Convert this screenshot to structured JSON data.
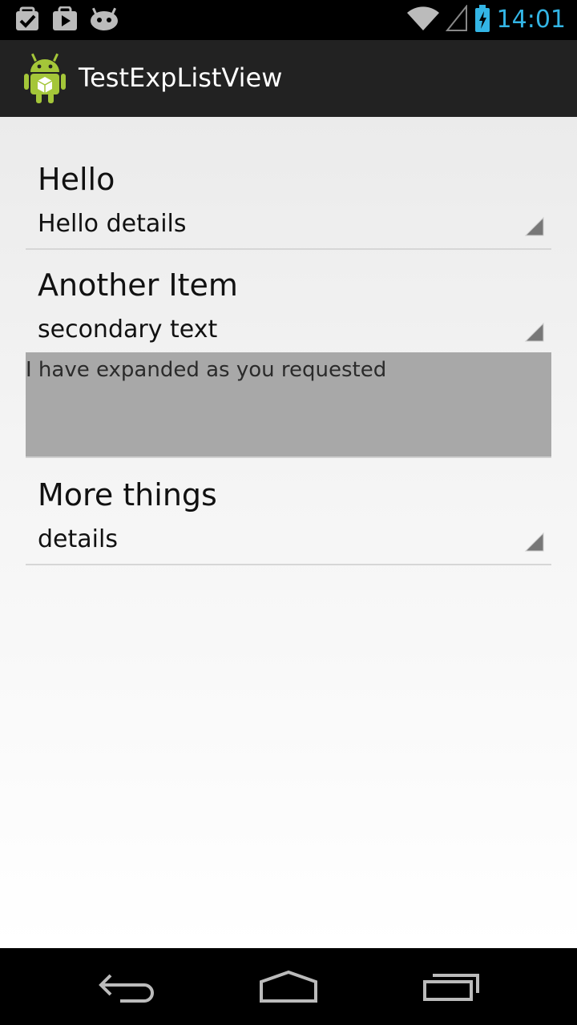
{
  "status_bar": {
    "time": "14:01",
    "accent_color": "#33b5e5",
    "left_icons": [
      "checkbox-icon",
      "play-store-icon",
      "android-debug-icon"
    ],
    "right_icons": [
      "wifi-icon",
      "signal-icon",
      "battery-charging-icon"
    ]
  },
  "action_bar": {
    "title": "TestExpListView",
    "icon": "android-app-icon"
  },
  "list": {
    "groups": [
      {
        "title": "Hello",
        "detail": "Hello details",
        "expanded": false
      },
      {
        "title": "Another Item",
        "detail": "secondary text",
        "expanded": true,
        "children": [
          "I have expanded as you requested"
        ]
      },
      {
        "title": "More things",
        "detail": "details",
        "expanded": false
      }
    ]
  },
  "nav_bar": {
    "buttons": [
      "back-icon",
      "home-icon",
      "recent-apps-icon"
    ]
  }
}
